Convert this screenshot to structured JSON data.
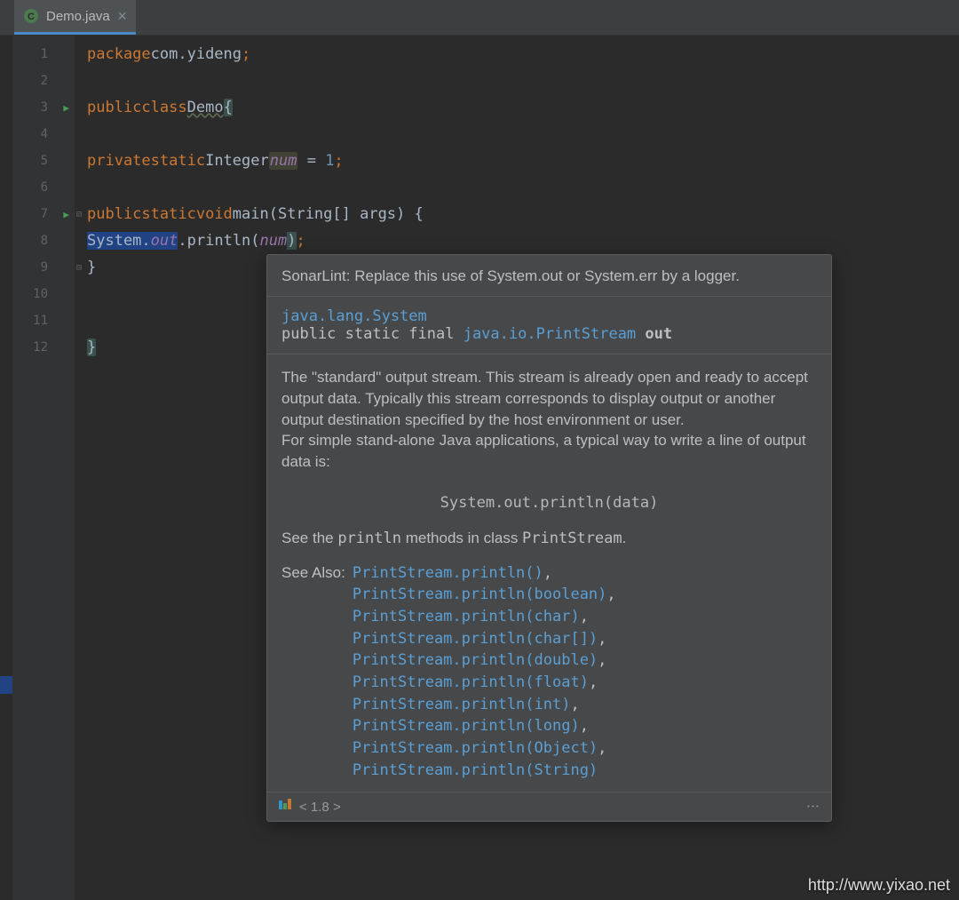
{
  "tab": {
    "filename": "Demo.java"
  },
  "gutter": {
    "lines": [
      "1",
      "2",
      "3",
      "4",
      "5",
      "6",
      "7",
      "8",
      "9",
      "10",
      "11",
      "12"
    ],
    "runMarkers": [
      3,
      7
    ]
  },
  "code": {
    "l1": {
      "kw1": "package",
      "pkg": "com.yideng",
      "semi": ";"
    },
    "l3": {
      "kw1": "public",
      "kw2": "class",
      "cls": "Demo",
      "brace": "{"
    },
    "l5": {
      "kw1": "private",
      "kw2": "static",
      "type": "Integer",
      "field": "num",
      "eq": " = ",
      "val": "1",
      "semi": ";"
    },
    "l7": {
      "kw1": "public",
      "kw2": "static",
      "kw3": "void",
      "m": "main",
      "sig": "(String[] args) {",
      "open": "("
    },
    "l8": {
      "sys": "System",
      "dot1": ".",
      "out": "out",
      "dot2": ".",
      "pr": "println",
      "op": "(",
      "arg": "num",
      "cl": ")",
      "semi": ";"
    },
    "l9": {
      "brace": "}"
    },
    "l12": {
      "brace": "}"
    }
  },
  "tooltip": {
    "header": "SonarLint: Replace this use of System.out or System.err by a logger.",
    "sigClass": "java.lang.System",
    "sigLine": {
      "pre": "public static final ",
      "type": "java.io.PrintStream",
      "name": " out"
    },
    "body1": "The \"standard\" output stream. This stream is already open and ready to accept output data. Typically this stream corresponds to display output or another output destination specified by the host environment or user.",
    "body2": "For simple stand-alone Java applications, a typical way to write a line of output data is:",
    "codeSample": "System.out.println(data)",
    "seePre": "See the ",
    "seeMono1": "println",
    "seeMid": " methods in class ",
    "seeMono2": "PrintStream",
    "seeEnd": ".",
    "alsoLabel": "See Also:",
    "alsoLinks": [
      "PrintStream.println()",
      "PrintStream.println(boolean)",
      "PrintStream.println(char)",
      "PrintStream.println(char[])",
      "PrintStream.println(double)",
      "PrintStream.println(float)",
      "PrintStream.println(int)",
      "PrintStream.println(long)",
      "PrintStream.println(Object)",
      "PrintStream.println(String)"
    ],
    "level": "< 1.8 >"
  },
  "watermark": "http://www.yixao.net"
}
